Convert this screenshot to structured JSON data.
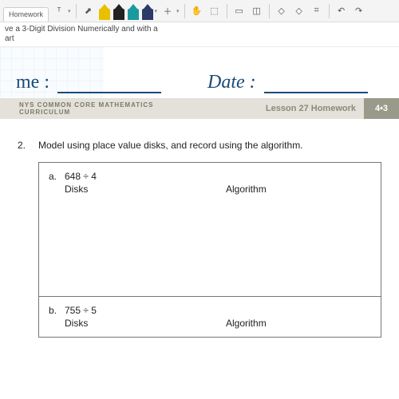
{
  "toolbar": {
    "tab_label": "Homework",
    "icons": {
      "text": "text-tool-icon",
      "plus": "add-icon",
      "hand": "hand-icon",
      "select": "select-icon",
      "page": "page-icon",
      "crop": "crop-icon",
      "shapes": "shapes-icon",
      "eraser": "eraser-icon",
      "grid": "grid-icon",
      "undo": "undo-icon",
      "redo": "redo-icon"
    }
  },
  "subtitle": {
    "line1": "ve a 3-Digit Division Numerically and with a",
    "line2": "art"
  },
  "handwritten": {
    "name_label": "me :",
    "date_label": "Date :"
  },
  "curriculum": {
    "left": "NYS COMMON CORE MATHEMATICS CURRICULUM",
    "mid": "Lesson 27 Homework",
    "badge": "4•3"
  },
  "question": {
    "number": "2.",
    "text": "Model using place value disks, and record using the algorithm.",
    "parts": [
      {
        "letter": "a.",
        "expr": "648 ÷ 4",
        "disks": "Disks",
        "algo": "Algorithm"
      },
      {
        "letter": "b.",
        "expr": "755 ÷ 5",
        "disks": "Disks",
        "algo": "Algorithm"
      }
    ]
  }
}
